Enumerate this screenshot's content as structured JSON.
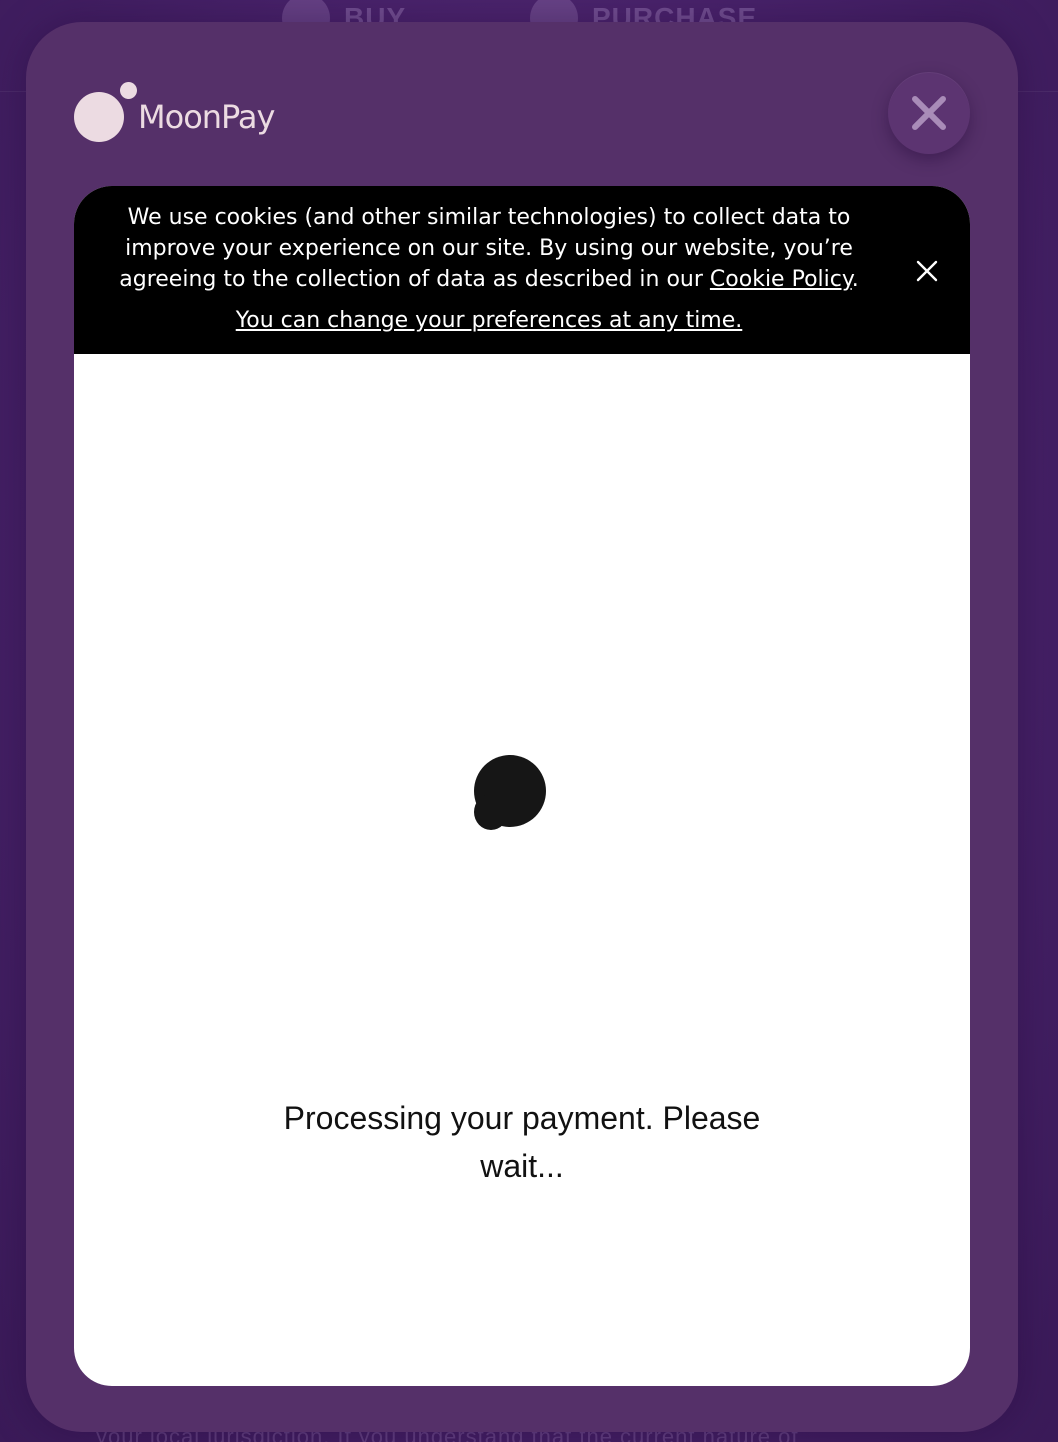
{
  "background": {
    "tabs": [
      {
        "label": "BUY",
        "icon": "buy-icon"
      },
      {
        "label": "PURCHASE",
        "icon": "purchase-icon"
      }
    ],
    "footer_text": "your local jurisdiction. If you understand that the current nature of"
  },
  "modal": {
    "brand": "MoonPay",
    "close_icon": "close-icon",
    "colors": {
      "backdrop": "#4a2468",
      "modal": "#553069",
      "logo": "#ecdbe2",
      "cookie_banner": "#000000"
    }
  },
  "cookie_banner": {
    "text_before": "We use cookies (and other similar technologies) to collect data to improve your experience on our site. By using our website, you’re agreeing to the collection of data as described in our ",
    "policy_link": "Cookie Policy",
    "text_after": ".",
    "preferences_link": "You can change your preferences at any time.",
    "close_icon": "close-icon"
  },
  "status": {
    "message": "Processing your payment. Please wait..."
  }
}
